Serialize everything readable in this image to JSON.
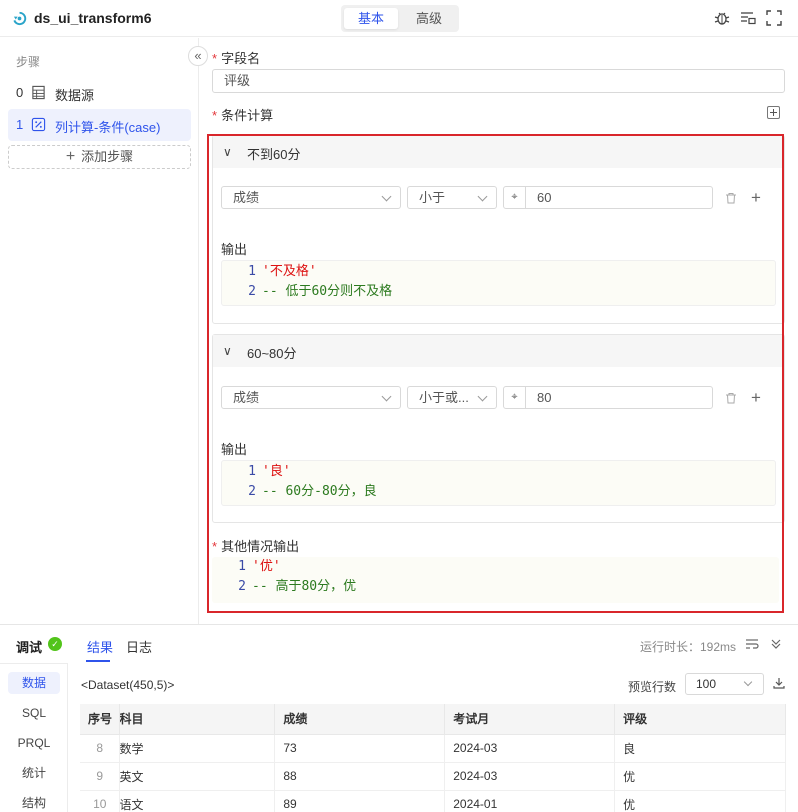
{
  "header": {
    "title": "ds_ui_transform6",
    "tabs": [
      {
        "label": "基本",
        "active": true
      },
      {
        "label": "高级",
        "active": false
      }
    ],
    "icons": [
      "bug-icon",
      "list-settings-icon",
      "fullscreen-icon"
    ]
  },
  "sidebar": {
    "title": "步骤",
    "collapse_glyph": "«",
    "steps": [
      {
        "num": "0",
        "label": "数据源",
        "icon": "table-icon"
      },
      {
        "num": "1",
        "label": "列计算-条件(case)",
        "icon": "percent-icon",
        "active": true
      }
    ],
    "add_step_label": "添加步骤"
  },
  "form": {
    "field_name_label": "字段名",
    "field_name_value": "评级",
    "condition_label": "条件计算",
    "cases": [
      {
        "title": "不到60分",
        "field": "成绩",
        "operator": "小于",
        "value": "60",
        "output_label": "输出",
        "code": [
          {
            "n": "1",
            "text": "'不及格'",
            "kind": "str"
          },
          {
            "n": "2",
            "text": "-- 低于60分则不及格",
            "kind": "cmt"
          }
        ]
      },
      {
        "title": "60~80分",
        "field": "成绩",
        "operator": "小于或...",
        "value": "80",
        "output_label": "输出",
        "code": [
          {
            "n": "1",
            "text": "'良'",
            "kind": "str"
          },
          {
            "n": "2",
            "text": "-- 60分-80分，良",
            "kind": "cmt"
          }
        ]
      }
    ],
    "else_label": "其他情况输出",
    "else_code": [
      {
        "n": "1",
        "text": "'优'",
        "kind": "str"
      },
      {
        "n": "2",
        "text": "-- 高于80分，优",
        "kind": "cmt"
      }
    ]
  },
  "debug": {
    "title": "调试",
    "tabs": [
      {
        "label": "结果",
        "active": true
      },
      {
        "label": "日志",
        "active": false
      }
    ],
    "runtime": "运行时长：192ms",
    "nav": [
      {
        "label": "数据",
        "active": true
      },
      {
        "label": "SQL"
      },
      {
        "label": "PRQL"
      },
      {
        "label": "统计"
      },
      {
        "label": "结构"
      }
    ],
    "dataset_label": "<Dataset(450,5)>",
    "preview_label": "预览行数",
    "preview_value": "100",
    "table": {
      "columns": [
        "序号",
        "科目",
        "成绩",
        "考试月",
        "评级"
      ],
      "rows": [
        [
          "8",
          "数学",
          "73",
          "2024-03",
          "良"
        ],
        [
          "9",
          "英文",
          "88",
          "2024-03",
          "优"
        ],
        [
          "10",
          "语文",
          "89",
          "2024-01",
          "优"
        ]
      ]
    }
  },
  "colors": {
    "accent": "#2f54eb",
    "highlight_frame": "#d9262b",
    "success": "#52c41a",
    "required": "#e3373b"
  }
}
